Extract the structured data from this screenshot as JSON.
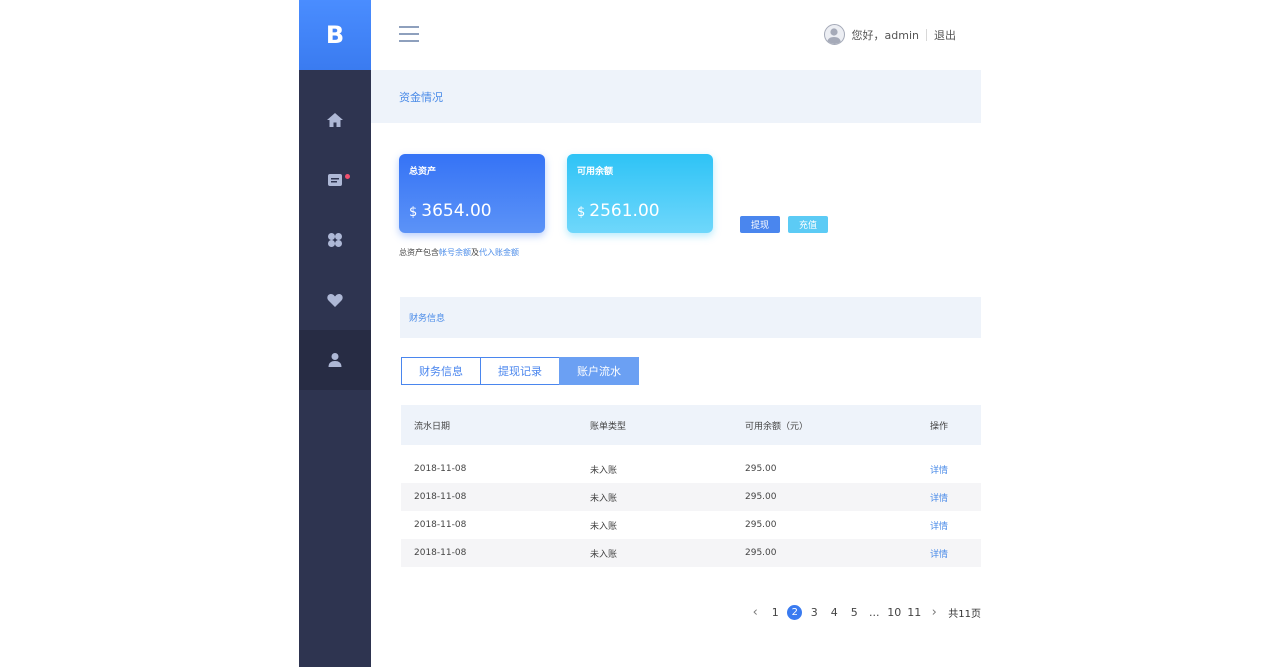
{
  "logo": "B",
  "sidebar": {
    "items": [
      {
        "icon": "home-icon"
      },
      {
        "icon": "message-icon",
        "badge": true
      },
      {
        "icon": "apps-icon"
      },
      {
        "icon": "heart-icon"
      },
      {
        "icon": "user-icon",
        "active": true
      }
    ]
  },
  "header": {
    "greeting": "您好，admin",
    "logout": "退出"
  },
  "funds": {
    "title": "资金情况",
    "total": {
      "label": "总资产",
      "currency": "$",
      "amount": "3654.00"
    },
    "available": {
      "label": "可用余额",
      "currency": "$",
      "amount": "2561.00"
    },
    "withdraw_label": "提现",
    "recharge_label": "充值",
    "note_prefix": "总资产包含",
    "note_hl1": "帐号余额",
    "note_mid": "及",
    "note_hl2": "代入账金额"
  },
  "finance": {
    "title": "财务信息",
    "tabs": [
      "财务信息",
      "提现记录",
      "账户流水"
    ],
    "active_tab": 2,
    "columns": [
      "流水日期",
      "账单类型",
      "可用余额（元）",
      "操作"
    ],
    "rows": [
      {
        "date": "2018-11-08",
        "type": "未入账",
        "balance": "295.00",
        "action": "详情"
      },
      {
        "date": "2018-11-08",
        "type": "未入账",
        "balance": "295.00",
        "action": "详情"
      },
      {
        "date": "2018-11-08",
        "type": "未入账",
        "balance": "295.00",
        "action": "详情"
      },
      {
        "date": "2018-11-08",
        "type": "未入账",
        "balance": "295.00",
        "action": "详情"
      }
    ]
  },
  "pagination": {
    "prev": "‹",
    "pages": [
      "1",
      "2",
      "3",
      "4",
      "5",
      "...",
      "10",
      "11"
    ],
    "current": "2",
    "next": "›",
    "total": "共11页"
  },
  "colors": {
    "accent": "#3a7bf0",
    "sidebar": "#2e3450",
    "badge": "#f0506e"
  }
}
